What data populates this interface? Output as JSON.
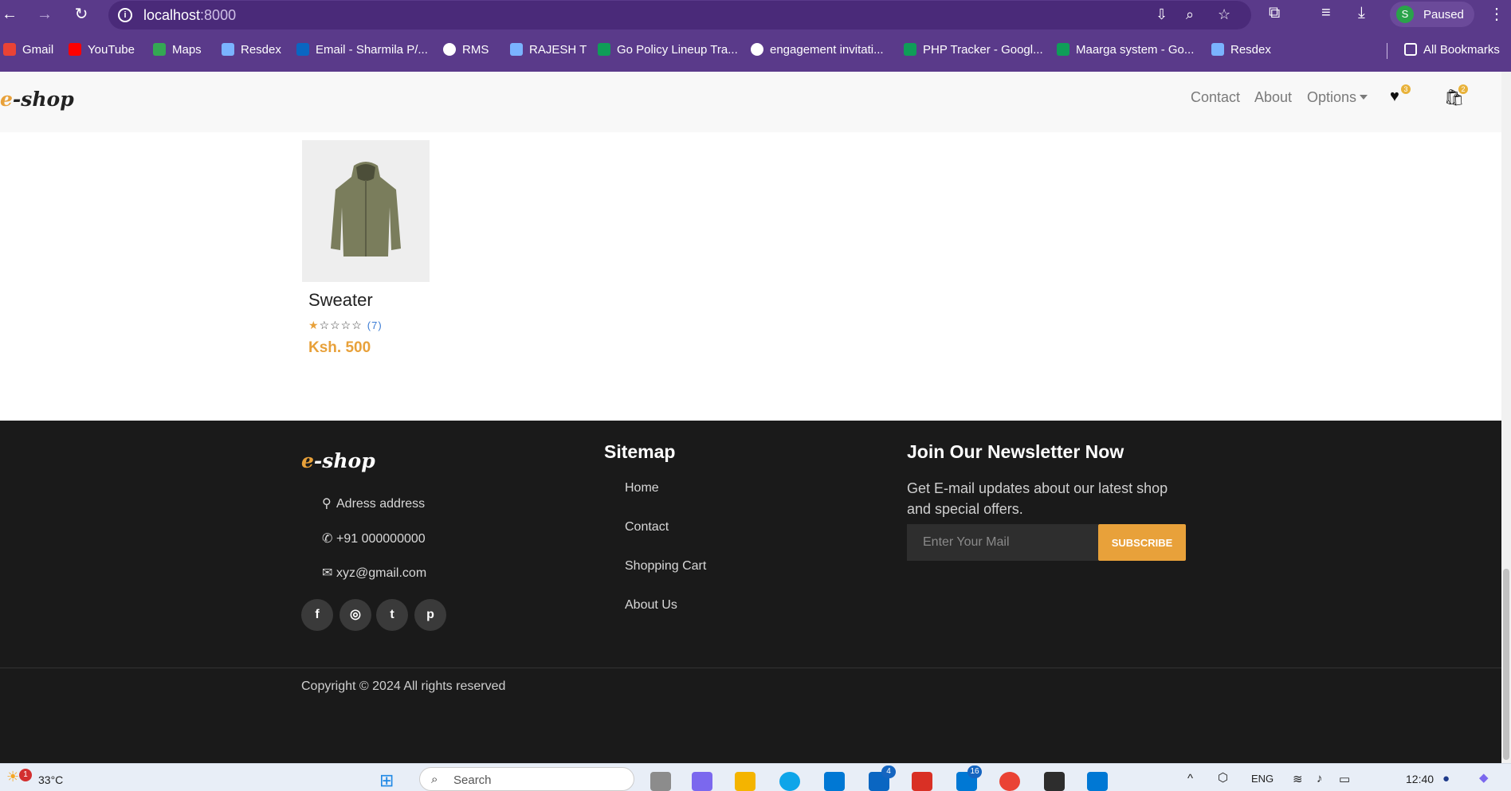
{
  "browser": {
    "url_host": "localhost",
    "url_port": ":8000",
    "profile_initial": "S",
    "profile_label": "Paused",
    "bookmarks": [
      {
        "label": "Gmail",
        "color": "#ea4335"
      },
      {
        "label": "YouTube",
        "color": "#ff0000"
      },
      {
        "label": "Maps",
        "color": "#34a853"
      },
      {
        "label": "Resdex",
        "color": "#7ab3ff"
      },
      {
        "label": "Email - Sharmila P/...",
        "color": "#0a66c2"
      },
      {
        "label": "RMS",
        "color": "#ffffff"
      },
      {
        "label": "RAJESH T",
        "color": "#7ab3ff"
      },
      {
        "label": "Go Policy Lineup Tra...",
        "color": "#0f9d58"
      },
      {
        "label": "engagement invitati...",
        "color": "#ffffff"
      },
      {
        "label": "PHP Tracker - Googl...",
        "color": "#0f9d58"
      },
      {
        "label": "Maarga system - Go...",
        "color": "#0f9d58"
      },
      {
        "label": "Resdex",
        "color": "#7ab3ff"
      }
    ],
    "all_bookmarks": "All Bookmarks"
  },
  "site": {
    "logo_e": "e",
    "logo_rest": "-shop",
    "nav": {
      "contact": "Contact",
      "about": "About",
      "options": "Options",
      "wishlist_count": "3",
      "cart_count": "2"
    },
    "product": {
      "name": "Sweater",
      "stars_filled": "★",
      "stars_empty": "☆☆☆☆",
      "review_count": "(7)",
      "price": "Ksh. 500",
      "rating": 1
    }
  },
  "footer": {
    "address": "Adress address",
    "phone": "+91 000000000",
    "email": "xyz@gmail.com",
    "sitemap_heading": "Sitemap",
    "sitemap_links": [
      "Home",
      "Contact",
      "Shopping Cart",
      "About Us"
    ],
    "newsletter_heading": "Join Our Newsletter Now",
    "newsletter_text": "Get E-mail updates about our latest shop and special offers.",
    "email_placeholder": "Enter Your Mail",
    "subscribe_label": "SUBSCRIBE",
    "copyright": "Copyright © 2024 All rights reserved"
  },
  "taskbar": {
    "weather_badge": "1",
    "temperature": "33°C",
    "search_placeholder": "Search",
    "badge_outlook": "4",
    "badge_mail": "16",
    "language": "ENG",
    "time": "12:40"
  },
  "colors": {
    "browser_chrome": "#5a3a8a",
    "accent": "#e8a13a",
    "footer_bg": "#1a1a1a"
  }
}
